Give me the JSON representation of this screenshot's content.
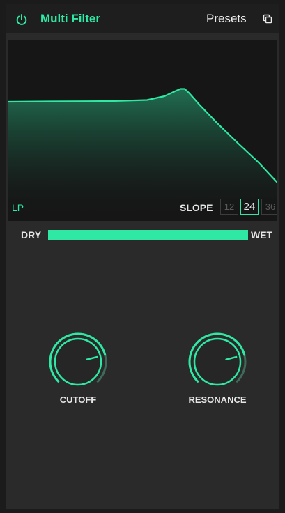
{
  "header": {
    "title": "Multi Filter",
    "presets_label": "Presets",
    "power_icon": "power-icon",
    "copy_icon": "copy-icon"
  },
  "filter": {
    "mode": "LP",
    "slope_label": "SLOPE",
    "slope_options": [
      "12",
      "24",
      "36"
    ],
    "slope_selected": "24"
  },
  "mix": {
    "dry_label": "DRY",
    "wet_label": "WET",
    "value_fraction": 1.0
  },
  "knobs": {
    "cutoff": {
      "label": "CUTOFF",
      "value_fraction": 0.78
    },
    "resonance": {
      "label": "RESONANCE",
      "value_fraction": 0.78
    }
  },
  "colors": {
    "accent": "#2ee8a4",
    "panel": "#2a2a2a",
    "header": "#1e1e1e",
    "display": "#161616",
    "text": "#e6e6e6",
    "inactive": "#5a5a5a"
  }
}
